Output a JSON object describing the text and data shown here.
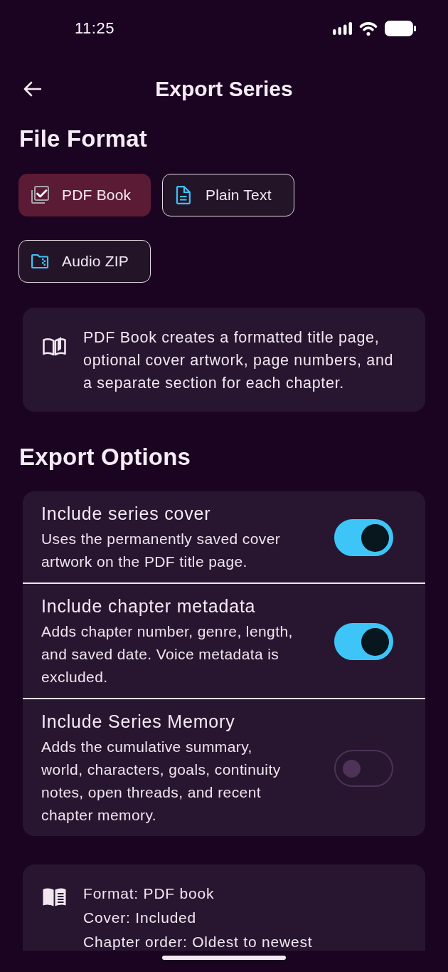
{
  "status_bar": {
    "time": "11:25"
  },
  "header": {
    "title": "Export Series"
  },
  "file_format": {
    "heading": "File Format",
    "options": [
      {
        "label": "PDF Book",
        "kind": "pdf",
        "selected": true
      },
      {
        "label": "Plain Text",
        "kind": "text",
        "selected": false
      },
      {
        "label": "Audio ZIP",
        "kind": "zip",
        "selected": false
      }
    ],
    "description": "PDF Book creates a formatted title page, optional cover artwork, page numbers, and a separate section for each chapter."
  },
  "export_options": {
    "heading": "Export Options",
    "items": [
      {
        "title": "Include series cover",
        "description": "Uses the permanently saved cover artwork on the PDF title page.",
        "on": true
      },
      {
        "title": "Include chapter metadata",
        "description": "Adds chapter number, genre, length, and saved date. Voice metadata is excluded.",
        "on": true
      },
      {
        "title": "Include Series Memory",
        "description": "Adds the cumulative summary, world, characters, goals, continuity notes, open threads, and recent chapter memory.",
        "on": false
      }
    ]
  },
  "summary": {
    "lines": [
      "Format: PDF book",
      "Cover: Included",
      "Chapter order: Oldest to newest"
    ]
  }
}
